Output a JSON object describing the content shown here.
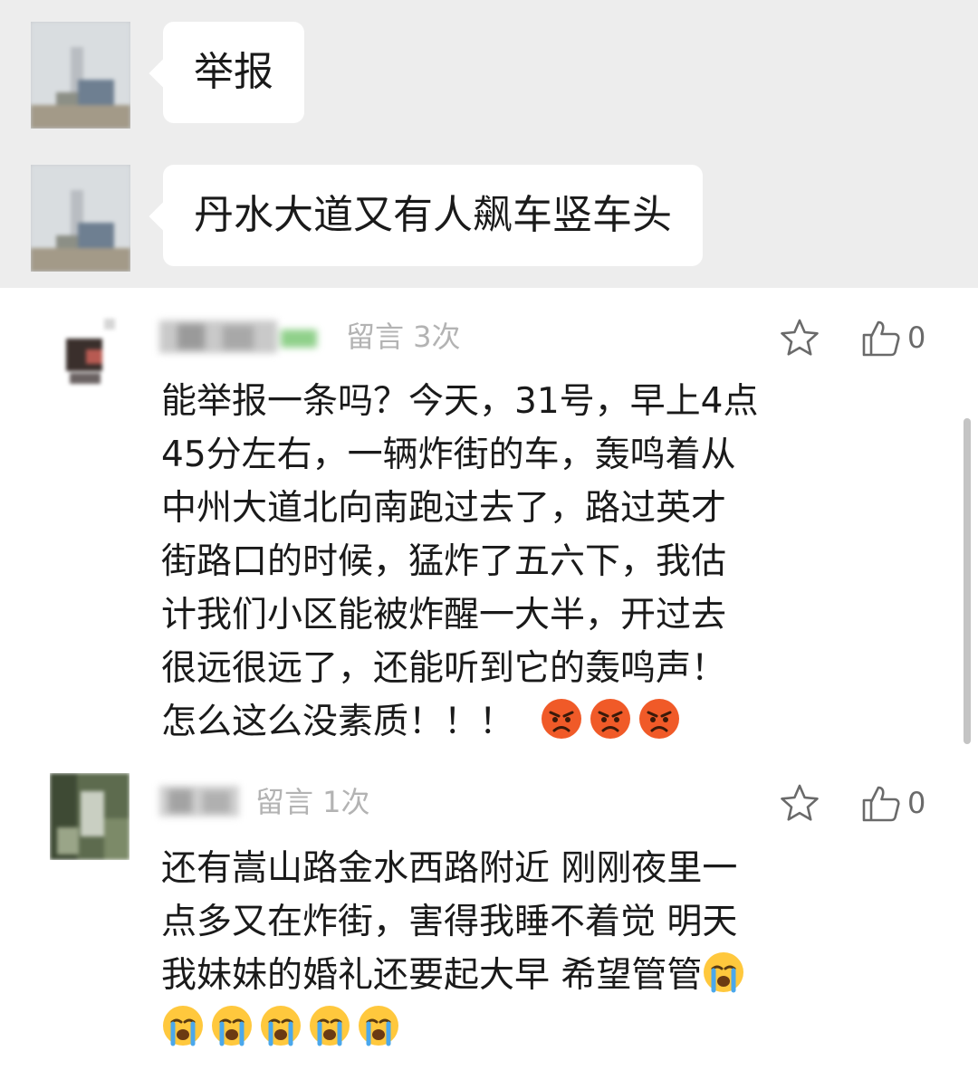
{
  "chat": {
    "messages": [
      {
        "text": "举报"
      },
      {
        "text": "丹水大道又有人飙车竖车头"
      }
    ]
  },
  "comments": [
    {
      "meta": "留言 3次",
      "likes": "0",
      "lines": [
        "能举报一条吗？今天，31号，早上4点",
        "45分左右，一辆炸街的车，轰鸣着从",
        "中州大道北向南跑过去了，路过英才",
        "街路口的时候，猛炸了五六下，我估",
        "计我们小区能被炸醒一大半，开过去",
        "很远很远了，还能听到它的轰鸣声！",
        "怎么这么没素质！！！"
      ],
      "trailing_emoji": [
        "angry-face",
        "angry-face",
        "angry-face"
      ]
    },
    {
      "meta": "留言 1次",
      "likes": "0",
      "lines": [
        "还有嵩山路金水西路附近 刚刚夜里一",
        "点多又在炸街，害得我睡不着觉 明天",
        "我妹妹的婚礼还要起大早 希望管管"
      ],
      "trailing_emoji": [
        "loudly-crying-face",
        "loudly-crying-face",
        "loudly-crying-face",
        "loudly-crying-face",
        "loudly-crying-face",
        "loudly-crying-face"
      ]
    }
  ],
  "colors": {
    "chat_background": "#ededed",
    "bubble": "#ffffff",
    "meta_text": "#b3b3b3",
    "angry_emoji": "#f05a28",
    "crying_emoji": "#ffc83d"
  }
}
